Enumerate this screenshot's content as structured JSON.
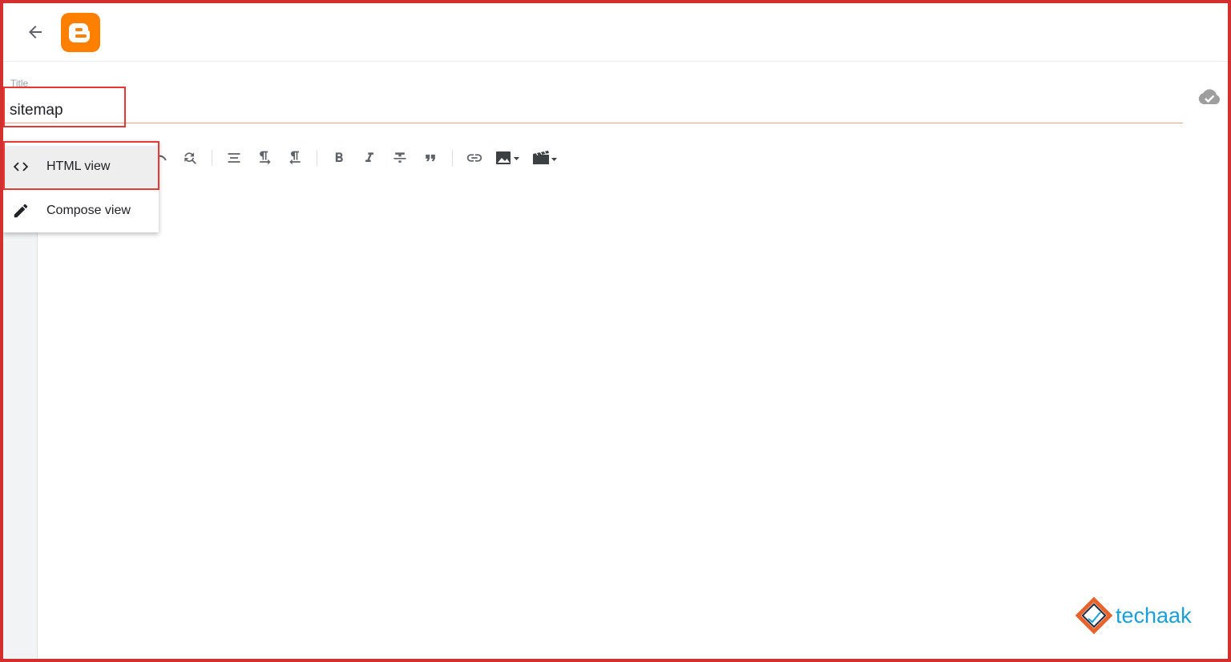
{
  "header": {
    "back_icon": "arrow-left-icon",
    "logo_icon": "blogger-logo-icon",
    "logo_color": "#ff8000"
  },
  "post": {
    "title_label": "Title",
    "title_value": "sitemap",
    "save_status_icon": "cloud-check-icon"
  },
  "toolbar": {
    "icons": [
      "find-replace-icon",
      "align-icon",
      "ltr-paragraph-icon",
      "rtl-paragraph-icon",
      "bold-icon",
      "italic-icon",
      "strikethrough-icon",
      "quote-icon",
      "link-icon",
      "insert-image-icon",
      "insert-video-icon"
    ]
  },
  "view_menu": {
    "items": [
      {
        "label": "HTML view",
        "icon": "code-icon",
        "active": true
      },
      {
        "label": "Compose view",
        "icon": "pencil-icon",
        "active": false
      }
    ]
  },
  "watermark": {
    "text": "techaak",
    "color": "#1a9fd4"
  },
  "colors": {
    "highlight": "#e53935",
    "title_underline": "#f4a38b",
    "frame": "#d32f2f"
  }
}
